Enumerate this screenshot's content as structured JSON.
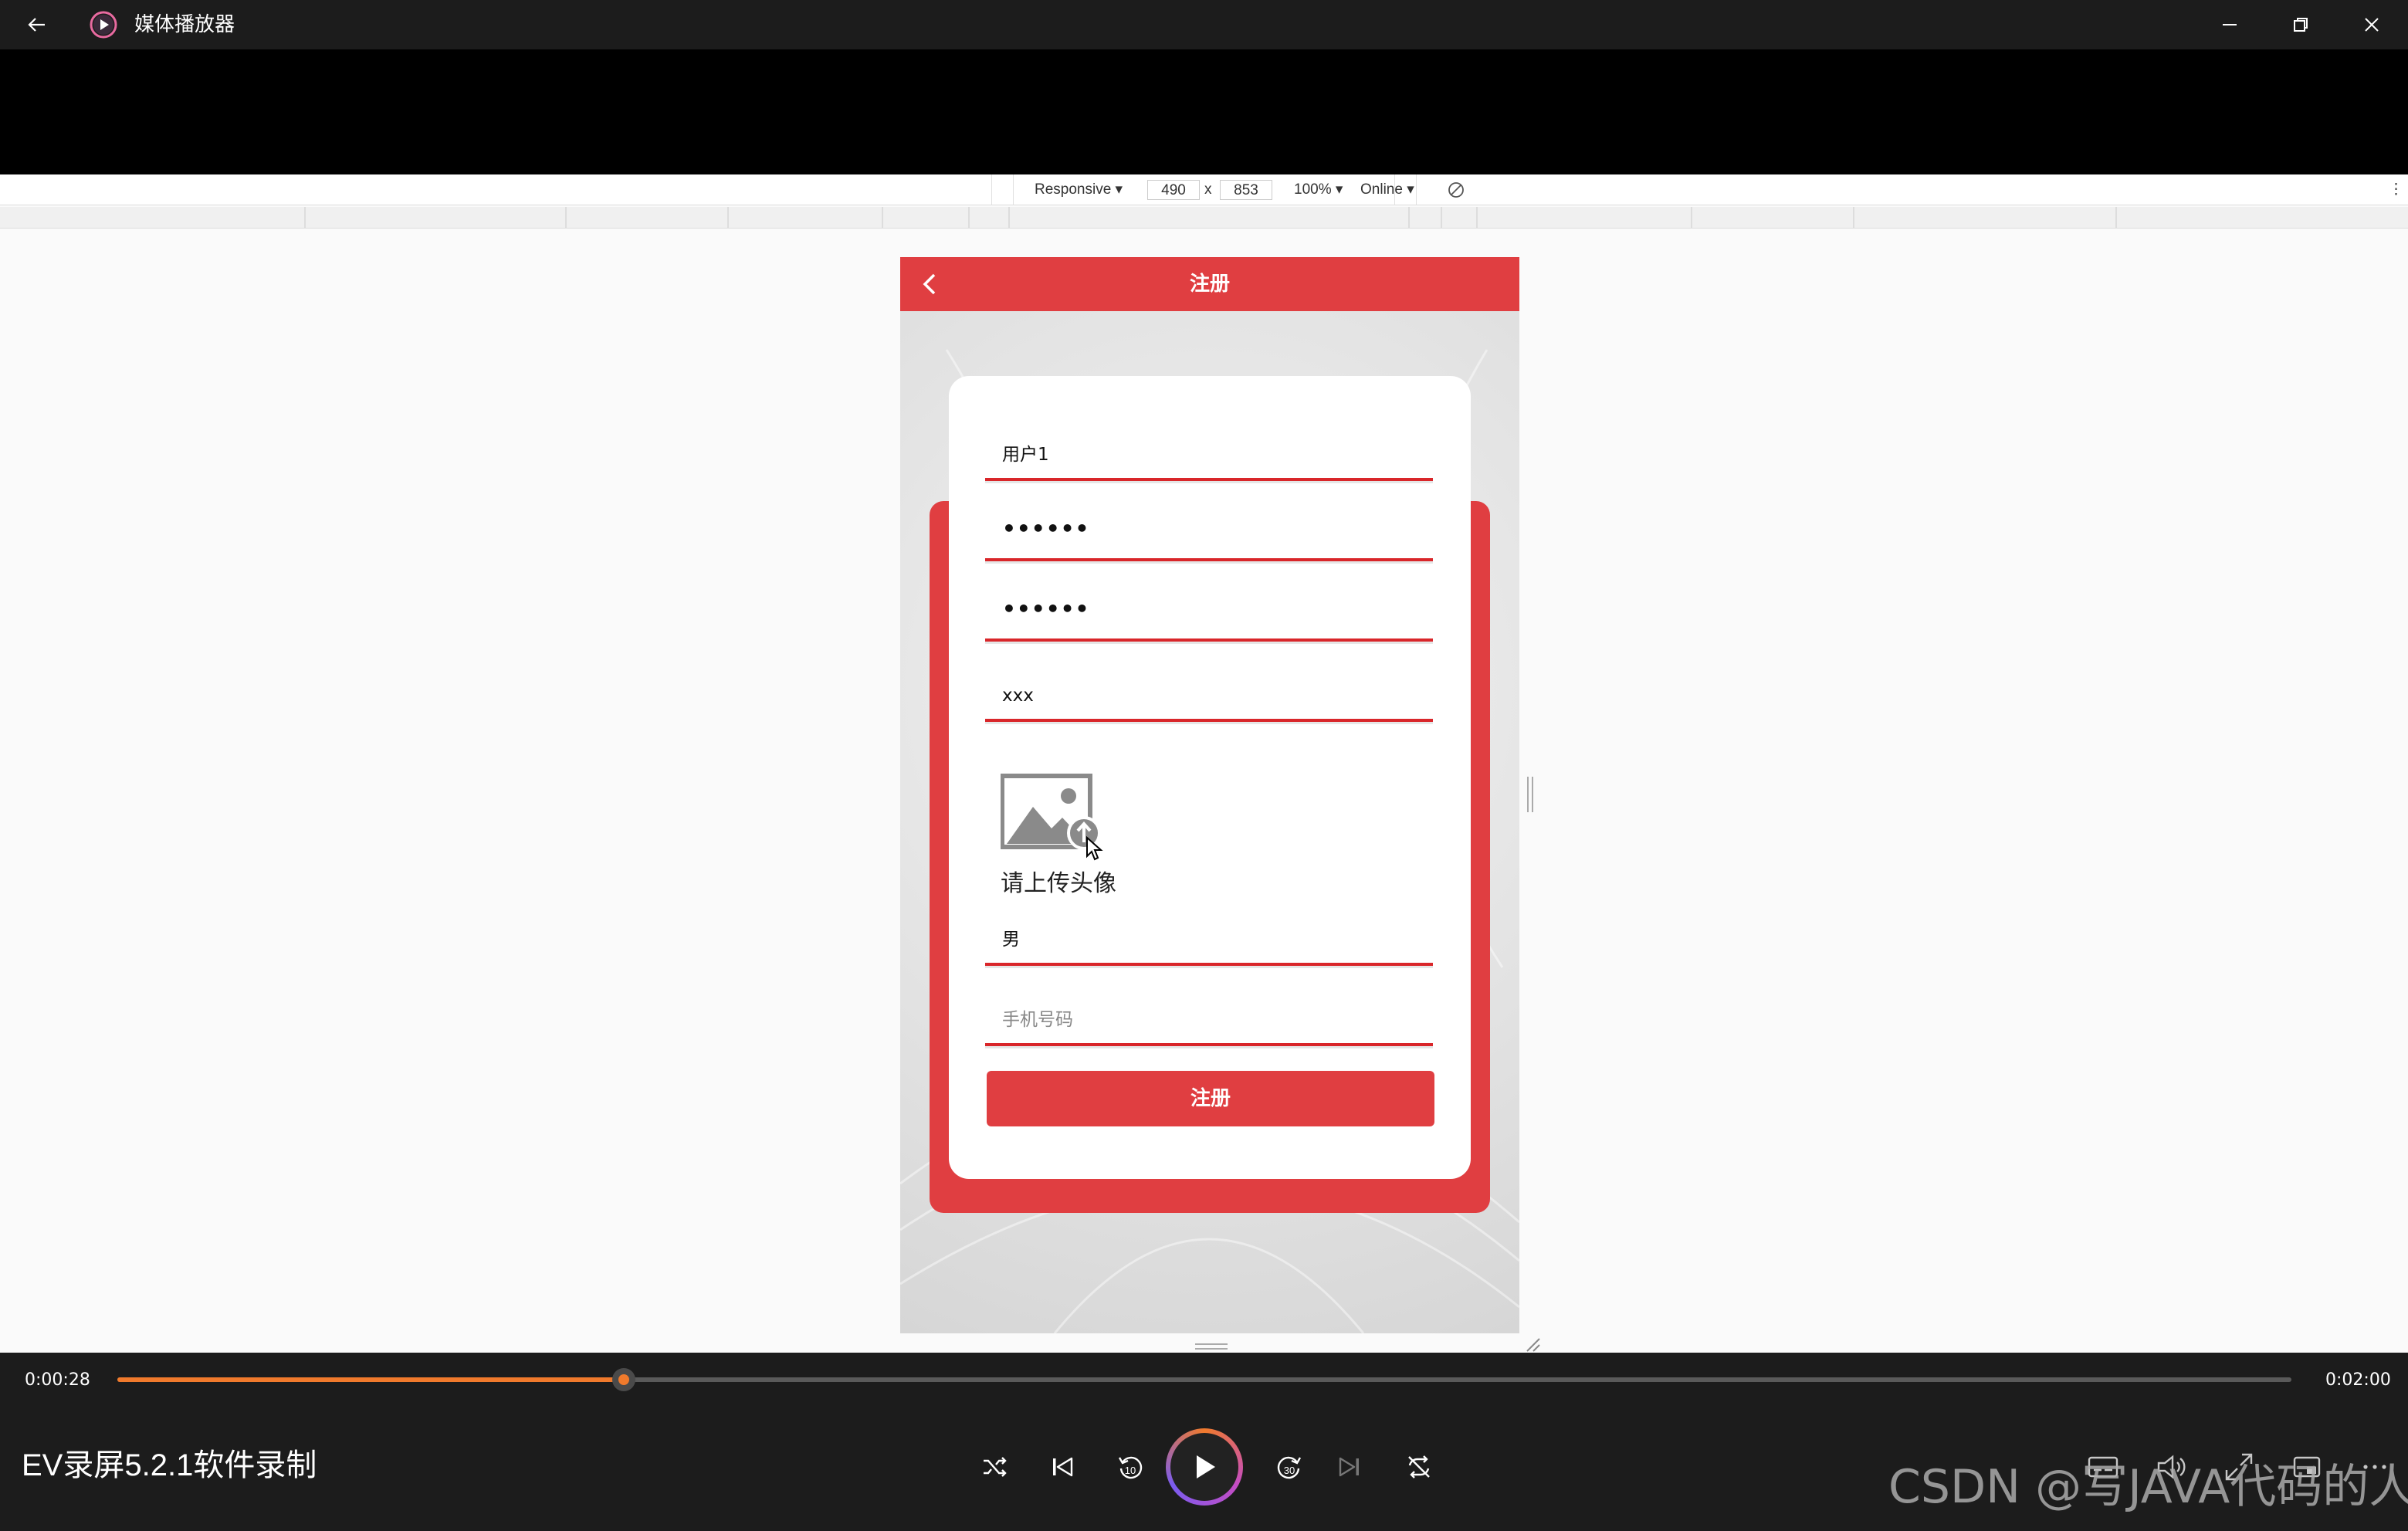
{
  "window": {
    "title": "媒体播放器",
    "back_icon": "arrow-left-icon",
    "app_icon": "media-player-icon",
    "minimize_icon": "minimize-icon",
    "maximize_icon": "restore-icon",
    "close_icon": "close-icon"
  },
  "devtools": {
    "device": "Responsive",
    "width": "490",
    "times": "x",
    "height": "853",
    "zoom": "100%",
    "throttle": "Online",
    "rotate_icon": "rotate-icon",
    "more_icon": "more-vertical-icon"
  },
  "app": {
    "nav_title": "注册",
    "back_icon": "chevron-left-icon",
    "fields": {
      "username": "用户1",
      "password": "••••••",
      "confirm_password": "••••••",
      "nickname": "xxx",
      "gender": "男",
      "phone_placeholder": "手机号码"
    },
    "upload_label": "请上传头像",
    "upload_icon": "image-upload-icon",
    "submit_label": "注册",
    "accent_color": "#e03e41"
  },
  "player": {
    "current_time": "0:00:28",
    "total_time": "0:02:00",
    "progress": 0.233,
    "media_title": "EV录屏5.2.1软件录制",
    "controls": [
      "shuffle-icon",
      "previous-icon",
      "rewind-10-icon",
      "play-icon",
      "forward-30-icon",
      "next-icon",
      "repeat-off-icon"
    ],
    "right_controls": [
      "subtitles-icon",
      "volume-icon",
      "fullscreen-icon",
      "mini-view-icon",
      "more-icon"
    ],
    "accent_color": "#f07a2c"
  },
  "watermark": "CSDN @写JAVA代码的人"
}
